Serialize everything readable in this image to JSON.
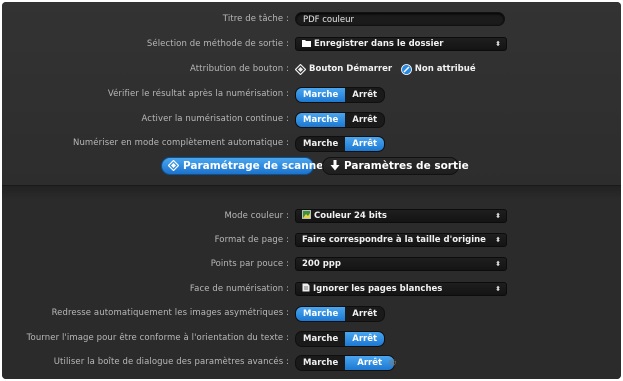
{
  "top": {
    "task_title": {
      "label": "Titre de tâche :",
      "value": "PDF couleur"
    },
    "output_method": {
      "label": "Sélection de méthode de sortie :",
      "value": "Enregistrer dans le dossier"
    },
    "button_assignment": {
      "label": "Attribution de bouton :",
      "option1": "Bouton Démarrer",
      "option2": "Non attribué"
    },
    "verify_after_scan": {
      "label": "Vérifier le résultat après la numérisation :",
      "on": "Marche",
      "off": "Arrêt",
      "selected": "on"
    },
    "continuous_scan": {
      "label": "Activer la numérisation continue :",
      "on": "Marche",
      "off": "Arrêt",
      "selected": "on"
    },
    "fully_auto": {
      "label": "Numériser en mode complètement automatique :",
      "on": "Marche",
      "off": "Arrêt",
      "selected": "off"
    }
  },
  "tabs": {
    "scanner_settings": "Paramétrage de scanner",
    "output_settings": "Paramètres de sortie"
  },
  "bottom": {
    "color_mode": {
      "label": "Mode couleur :",
      "value": "Couleur 24 bits"
    },
    "page_format": {
      "label": "Format de page :",
      "value": "Faire correspondre à la taille d'origine"
    },
    "dpi": {
      "label": "Points par pouce :",
      "value": "200 ppp"
    },
    "scan_side": {
      "label": "Face de numérisation :",
      "value": "Ignorer les pages blanches"
    },
    "auto_straighten": {
      "label": "Redresse automatiquement les images asymétriques :",
      "on": "Marche",
      "off": "Arrêt",
      "selected": "on"
    },
    "rotate_orientation": {
      "label": "Tourner l'image pour être conforme à l'orientation du texte :",
      "on": "Marche",
      "off": "Arrêt",
      "selected": "off"
    },
    "advanced_dialog": {
      "label": "Utiliser la boîte de dialogue des paramètres avancés :",
      "on": "Marche",
      "off": "Arrêt",
      "selected": "off"
    }
  },
  "colors": {
    "accent": "#2a8ae0",
    "panel": "#2c2c2c",
    "label": "#b8b8b8"
  },
  "icons": {
    "output_method": "folder-icon",
    "button_radio1": "diamond-radio-icon",
    "button_radio2": "selected-radio-icon",
    "tab_scanner": "diamond-icon",
    "tab_output": "download-arrow-icon",
    "color_mode": "color-photo-icon",
    "scan_side": "page-icon",
    "advanced": "gear-icon"
  }
}
